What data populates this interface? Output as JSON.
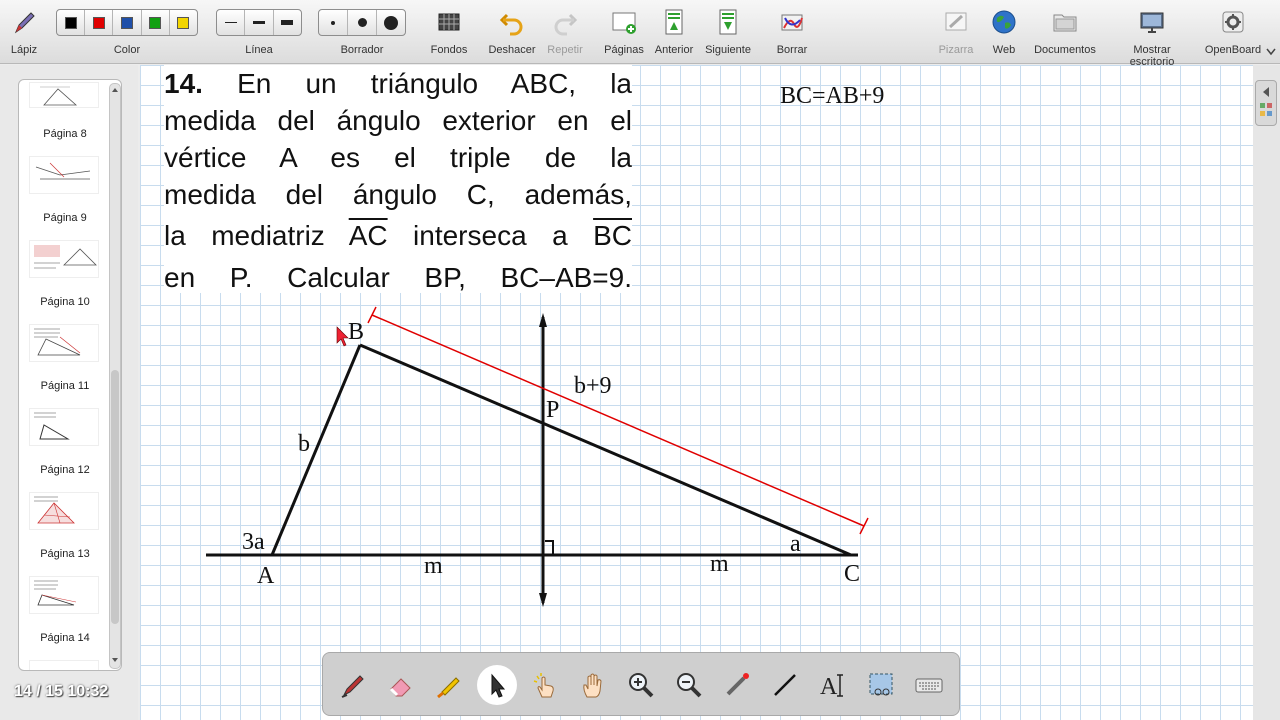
{
  "toolbar": {
    "pen": "Lápiz",
    "color": "Color",
    "line": "Línea",
    "eraser": "Borrador",
    "backgrounds": "Fondos",
    "undo": "Deshacer",
    "redo": "Repetir",
    "pages": "Páginas",
    "previous": "Anterior",
    "next": "Siguiente",
    "clear": "Borrar",
    "board": "Pizarra",
    "web": "Web",
    "documents": "Documentos",
    "show_desktop": "Mostrar escritorio",
    "openboard": "OpenBoard",
    "colors": [
      "#000000",
      "#e00000",
      "#1f4fa8",
      "#11a011",
      "#f3d500"
    ]
  },
  "sidebar": {
    "pages": [
      {
        "label": "Página 8"
      },
      {
        "label": "Página 9"
      },
      {
        "label": "Página 10"
      },
      {
        "label": "Página 11"
      },
      {
        "label": "Página 12"
      },
      {
        "label": "Página 13"
      },
      {
        "label": "Página 14"
      }
    ]
  },
  "status": {
    "page_time": "14 / 15 10:32"
  },
  "problem": {
    "number": "14.",
    "line1_rest": " En un triángulo ABC, la",
    "line2": "medida del ángulo exterior en el",
    "line3": "vértice A es el triple de la",
    "line4": "medida del ángulo C, además,",
    "line5_a": "la mediatriz ",
    "line5_seg1": "AC",
    "line5_b": " interseca a ",
    "line5_seg2": "BC",
    "line6": "en P. Calcular BP, BC–AB=9."
  },
  "note": "BC=AB+9",
  "figure": {
    "A": "A",
    "B": "B",
    "C": "C",
    "P": "P",
    "side_b": "b",
    "bc_len": "b+9",
    "angle_A": "3a",
    "angle_C": "a",
    "m_left": "m",
    "m_right": "m"
  },
  "accent": {
    "red": "#e00000",
    "grid": "#c8dcee"
  }
}
